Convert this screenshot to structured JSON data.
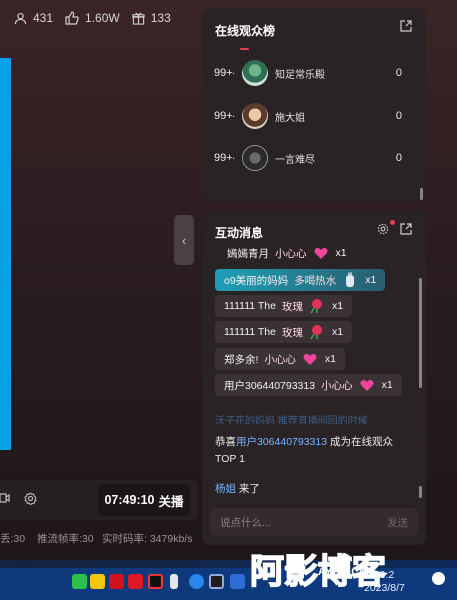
{
  "stats": {
    "viewers": "431",
    "likes": "1.60W",
    "gifts": "133"
  },
  "player": {
    "time": "07:49:10",
    "status": "关播"
  },
  "metrics": {
    "left_cut": "丢:30",
    "push_fps": "推流帧率:30",
    "bitrate": "实时码率: 3479kb/s"
  },
  "rank_panel": {
    "title": "在线观众榜",
    "rows": [
      {
        "rank": "99+",
        "name": "知足常乐殿",
        "score": "0"
      },
      {
        "rank": "99+",
        "name": "施大姐",
        "score": "0"
      },
      {
        "rank": "99+",
        "name": "一言难尽",
        "score": "0"
      }
    ]
  },
  "msg_panel": {
    "title": "互动消息",
    "gifts": [
      {
        "user": "嫣嫣青月",
        "gift": "小心心",
        "count": "x1"
      },
      {
        "user": "o9美丽的妈妈",
        "gift": "多喝热水",
        "count": "x1"
      },
      {
        "user": "111111 The",
        "gift": "玫瑰",
        "count": "x1"
      },
      {
        "user": "111111 The",
        "gift": "玫瑰",
        "count": "x1"
      },
      {
        "user": "郑多余!",
        "gift": "小心心",
        "count": "x1"
      },
      {
        "user": "用户306440793313",
        "gift": "小心心",
        "count": "x1"
      }
    ],
    "faded_line": "沃子花的妈妈 推荐直播间回的时候",
    "system": {
      "prefix": "恭喜",
      "user": "用户306440793313",
      "suffix": "成为在线观众TOP 1"
    },
    "join": {
      "user": "杨姐",
      "suffix": " 来了"
    },
    "input_placeholder": "说点什么...",
    "send_label": "发送"
  },
  "taskbar": {
    "time": "10:2",
    "date": "2023/8/7"
  },
  "watermark": {
    "text": "阿影博客",
    "site": "AYBK.CN"
  },
  "colors": {
    "accent_pink": "#e93b53",
    "link_blue": "#79b4ff",
    "highlight_chip": "#1f9fb4",
    "player_bar": "#0aa2e6"
  }
}
